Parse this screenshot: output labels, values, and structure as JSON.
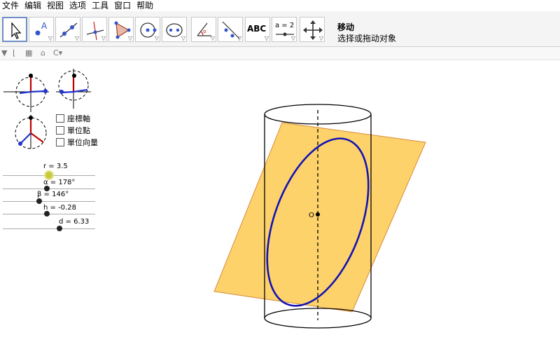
{
  "menu": [
    "文件",
    "编辑",
    "视图",
    "选项",
    "工具",
    "窗口",
    "帮助"
  ],
  "tool_info": {
    "title": "移动",
    "help": "选择或拖动对象"
  },
  "tools": {
    "text_label": "ABC",
    "slider_label": "a = 2"
  },
  "checkboxes": [
    "座標軸",
    "單位點",
    "單位向量"
  ],
  "sliders": [
    {
      "label": "r = 3.5"
    },
    {
      "label": "α = 178°"
    },
    {
      "label": "β = 146°"
    },
    {
      "label": "h = -0.28"
    },
    {
      "label": "d = 6.33"
    }
  ],
  "graphics": {
    "origin_label": "O",
    "colors": {
      "plane_fill": "#fdd26b",
      "plane_edge": "#d88a3a",
      "ellipse": "#1313b5",
      "cylinder": "#000000"
    }
  }
}
